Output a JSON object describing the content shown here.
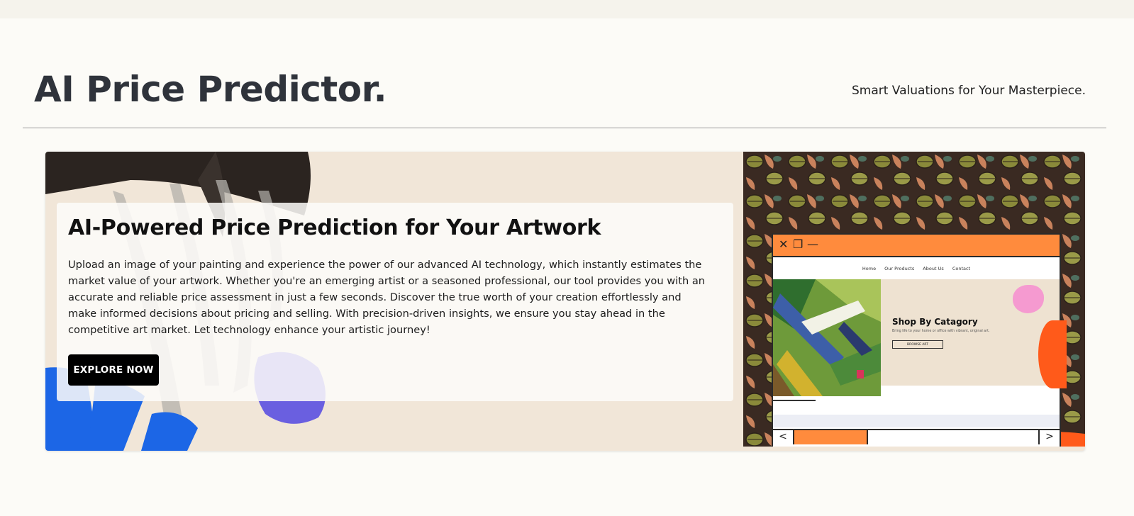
{
  "header": {
    "title": "AI Price Predictor.",
    "tagline": "Smart Valuations for Your Masterpiece."
  },
  "hero": {
    "heading": "AI-Powered Price Prediction for Your Artwork",
    "body": "Upload an image of your painting and experience the power of our advanced AI technology, which instantly estimates the market value of your artwork. Whether you're an emerging artist or a seasoned professional, our tool provides you with an accurate and reliable price assessment in just a few seconds. Discover the true worth of your creation effortlessly and make informed decisions about pricing and selling. With precision-driven insights, we ensure you stay ahead in the competitive art market. Let technology enhance your artistic journey!",
    "cta_label": "EXPLORE NOW"
  },
  "mockup": {
    "nav": [
      "Home",
      "Our Products",
      "About Us",
      "Contact"
    ],
    "heading": "Shop By Catagory",
    "subtext": "Bring life to your home or office with vibrant, original art.",
    "button_label": "BROWSE ART",
    "prev_arrow": "<",
    "next_arrow": ">",
    "window_icons": {
      "close": "✕",
      "restore": "❐",
      "minimize": "—"
    }
  },
  "colors": {
    "page_bg": "#fcfbf7",
    "title": "#2f333b",
    "hero_bg": "#f1e6d8",
    "button": "#000000",
    "mock_accent": "#ff8b3d"
  }
}
